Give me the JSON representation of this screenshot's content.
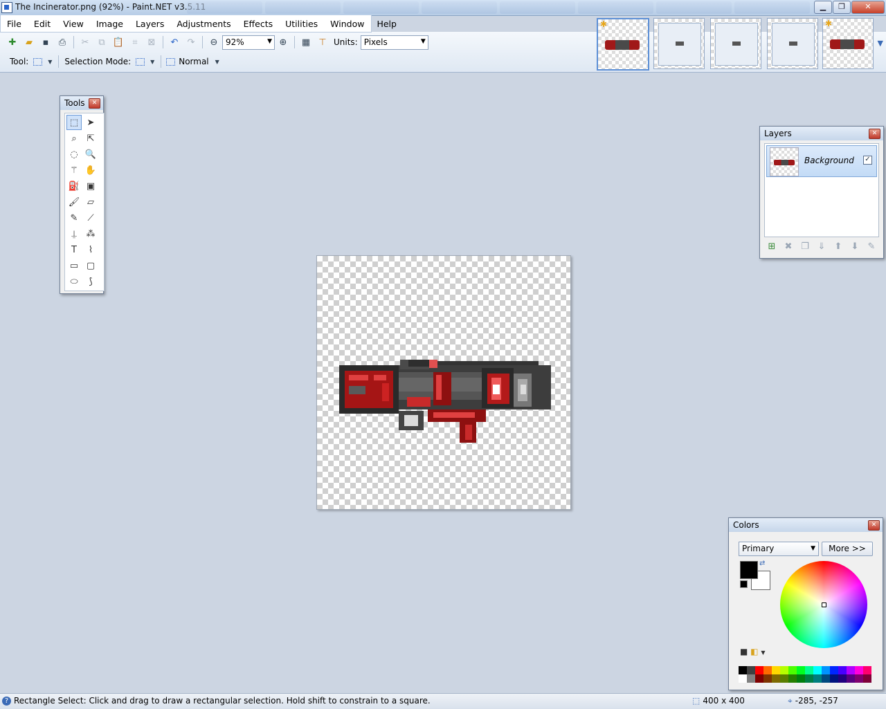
{
  "window": {
    "title": "The Incinerator.png (92%) - Paint.NET v3.5.11",
    "buttons": {
      "minimize": "▁",
      "maximize": "❐",
      "close": "✕"
    }
  },
  "menu": [
    "File",
    "Edit",
    "View",
    "Image",
    "Layers",
    "Adjustments",
    "Effects",
    "Utilities",
    "Window",
    "Help"
  ],
  "toolbar": {
    "zoom_value": "92%",
    "units_label": "Units:",
    "units_value": "Pixels",
    "tool_label": "Tool:",
    "selection_mode_label": "Selection Mode:",
    "blend_mode": "Normal"
  },
  "tools_panel": {
    "title": "Tools",
    "tools": [
      {
        "name": "rectangle-select",
        "glyph": "⬚"
      },
      {
        "name": "move-selected-pixels",
        "glyph": "➤"
      },
      {
        "name": "lasso-select",
        "glyph": "⌕"
      },
      {
        "name": "move-selection",
        "glyph": "⇱"
      },
      {
        "name": "ellipse-select",
        "glyph": "◌"
      },
      {
        "name": "zoom",
        "glyph": "🔍"
      },
      {
        "name": "magic-wand",
        "glyph": "⚚"
      },
      {
        "name": "pan",
        "glyph": "✋"
      },
      {
        "name": "paint-bucket",
        "glyph": "⛽"
      },
      {
        "name": "gradient",
        "glyph": "▣"
      },
      {
        "name": "paintbrush",
        "glyph": "🖌"
      },
      {
        "name": "eraser",
        "glyph": "▱"
      },
      {
        "name": "pencil",
        "glyph": "✎"
      },
      {
        "name": "color-picker",
        "glyph": "⟋"
      },
      {
        "name": "clone-stamp",
        "glyph": "⍊"
      },
      {
        "name": "recolor",
        "glyph": "⁂"
      },
      {
        "name": "text",
        "glyph": "T"
      },
      {
        "name": "line-curve",
        "glyph": "⌇"
      },
      {
        "name": "rectangle",
        "glyph": "▭"
      },
      {
        "name": "rounded-rectangle",
        "glyph": "▢"
      },
      {
        "name": "ellipse",
        "glyph": "⬭"
      },
      {
        "name": "freeform-shape",
        "glyph": "⟆"
      }
    ]
  },
  "layers_panel": {
    "title": "Layers",
    "layers": [
      {
        "name": "Background",
        "visible": true
      }
    ]
  },
  "colors_panel": {
    "title": "Colors",
    "mode": "Primary",
    "more_button": "More >>",
    "primary_color": "#000000",
    "secondary_color": "#ffffff",
    "palette_top": [
      "#000000",
      "#404040",
      "#ff0000",
      "#ff6a00",
      "#ffd800",
      "#b6ff00",
      "#4cff00",
      "#00ff21",
      "#00ff90",
      "#00ffff",
      "#0094ff",
      "#0026ff",
      "#4800ff",
      "#b200ff",
      "#ff00dc",
      "#ff006e"
    ],
    "palette_bottom": [
      "#ffffff",
      "#808080",
      "#7f0000",
      "#7f3300",
      "#7f6a00",
      "#5b7f00",
      "#267f00",
      "#007f0e",
      "#007f46",
      "#007f7f",
      "#004a7f",
      "#00137f",
      "#21007f",
      "#57007f",
      "#7f006e",
      "#7f0037"
    ]
  },
  "canvas": {
    "image_name": "The Incinerator.png",
    "zoom_percent": 92
  },
  "status": {
    "help_text": "Rectangle Select: Click and drag to draw a rectangular selection. Hold shift to constrain to a square.",
    "image_size": "400 x 400",
    "cursor_position": "-285, -257"
  }
}
